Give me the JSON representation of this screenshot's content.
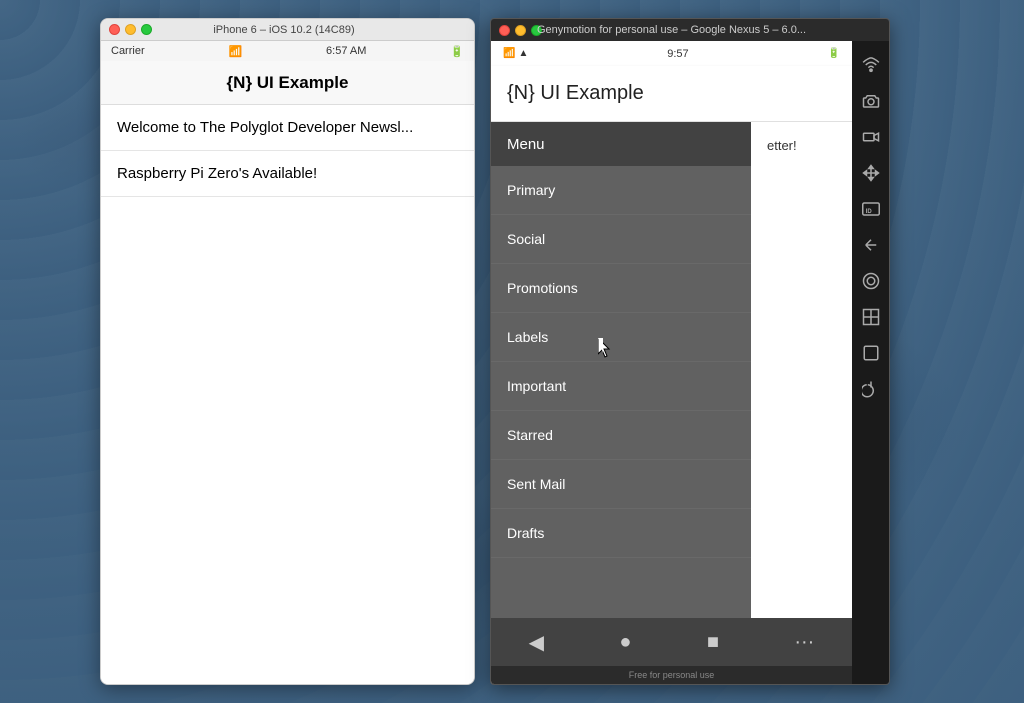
{
  "ios_simulator": {
    "titlebar_title": "iPhone 6 – iOS 10.2 (14C89)",
    "status_bar": {
      "carrier": "Carrier",
      "time": "6:57 AM",
      "battery": "🔋"
    },
    "nav_title": "{N} UI Example",
    "list_items": [
      "Welcome to The Polyglot Developer Newsl...",
      "Raspberry Pi Zero's Available!"
    ]
  },
  "android_simulator": {
    "titlebar_title": "Genymotion for personal use – Google Nexus 5 – 6.0...",
    "status_bar": {
      "time": "9:57",
      "icons": "🔋"
    },
    "app_title": "{N} UI Example",
    "drawer": {
      "header": "Menu",
      "items": [
        "Primary",
        "Social",
        "Promotions",
        "Labels",
        "Important",
        "Starred",
        "Sent Mail",
        "Drafts"
      ]
    },
    "main_content_partial": "etter!",
    "genymotion_label": "Free for personal use",
    "nav_buttons": [
      "◀",
      "●",
      "■",
      "···"
    ]
  },
  "genymotion_sidebar_icons": [
    "wifi-icon",
    "camera-icon",
    "video-icon",
    "move-icon",
    "id-icon",
    "back-icon",
    "home-icon",
    "apps-icon",
    "square-icon",
    "power-icon"
  ]
}
